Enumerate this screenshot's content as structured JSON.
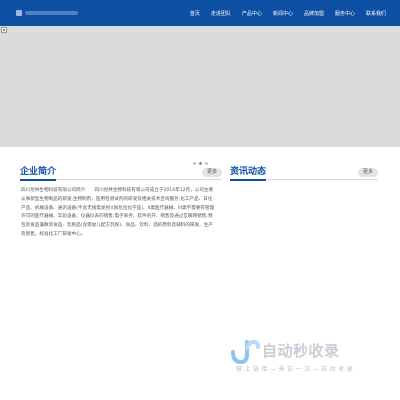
{
  "nav": {
    "items": [
      "首页",
      "走进团队",
      "产品中心",
      "新闻中心",
      "品牌加盟",
      "服务中心",
      "联系我们"
    ]
  },
  "about": {
    "title": "企业简介",
    "more": "更多",
    "text": "四川尼林生物科技有限公司简介　　四川尼林生物科技有限公司成立于2014年12月，公司主要从事新型生物制品的研发,生物制剂、医用检测试剂的研发及相关技术咨询服务;化工产品、日化产品、机械设备、通讯设备(不含无线电发射)(除危险化学品)、II类医疗器械、III类不需要有管理许可的医疗器械、实验设备、仪器仪表的销售;电子商务，软件的开、销售及通过互联网销售;预包装食品兼散装食品、乳制品(含婴幼儿配方乳粉)、食品、饮料、酒的原料及辅料的研发、生产及销售，标准化工厂研发中心。"
  },
  "news": {
    "title": "资讯动态",
    "more": "更多"
  },
  "watermark": {
    "title": "自动秒收录",
    "subtitle": "做 上 链 接 — 来 访 一 次 — 自 动 收 录"
  },
  "colors": {
    "header": "#0d4fa3",
    "accent": "#0d4fa3",
    "banner": "#dbdbdb"
  },
  "icons": {
    "banner": "broken-image-icon",
    "watermark": "link-logo-icon"
  }
}
